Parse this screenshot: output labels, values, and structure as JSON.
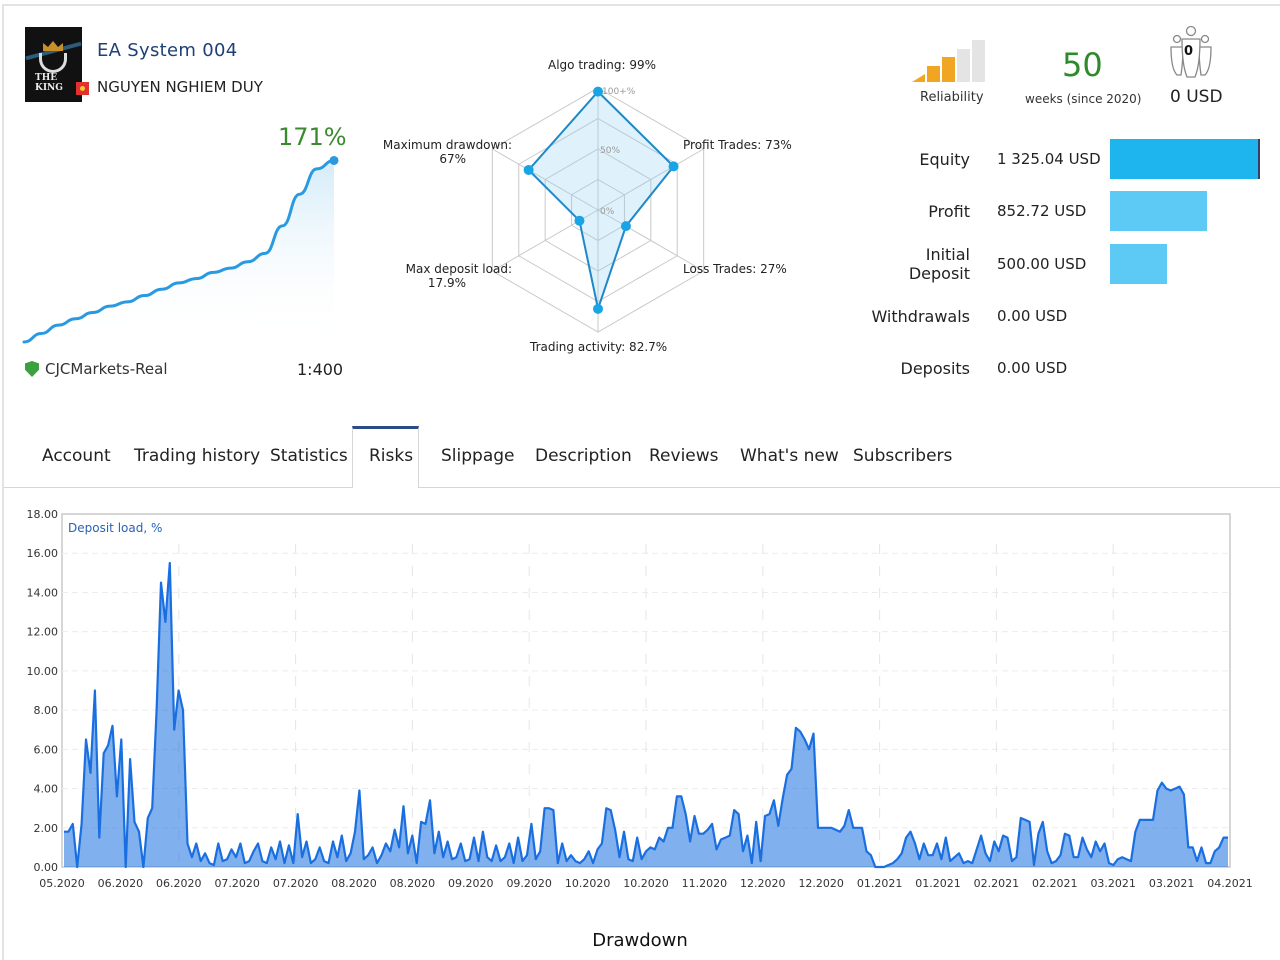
{
  "header": {
    "system_name": "EA System 004",
    "owner_name": "NGUYEN NGHIEM DUY",
    "avatar_text": "THE KING"
  },
  "growth": {
    "percent_label": "171%",
    "broker": "CJCMarkets-Real",
    "leverage": "1:400",
    "curve": [
      0,
      4,
      8,
      11,
      14,
      17,
      19,
      22,
      25,
      28,
      30,
      33,
      35,
      38,
      42,
      55,
      70,
      82,
      86
    ]
  },
  "radar": {
    "scale_labels": [
      "100+%",
      "50%",
      "0%"
    ],
    "axes": [
      {
        "label": "Algo trading: 99%",
        "value": 99
      },
      {
        "label": "Profit Trades: 73%",
        "value": 73
      },
      {
        "label": "Loss Trades: 27%",
        "value": 27
      },
      {
        "label": "Trading activity: 82.7%",
        "value": 82.7
      },
      {
        "label": "Max deposit load:\n17.9%",
        "value": 17.9
      },
      {
        "label": "Maximum drawdown:\n67%",
        "value": 67
      }
    ]
  },
  "stats": {
    "reliability_label": "Reliability",
    "reliability_level": 3,
    "reliability_max": 5,
    "weeks": "50",
    "weeks_label": "weeks (since 2020)",
    "subscribers_count": "0",
    "subscribers_funds": "0 USD"
  },
  "financials": [
    {
      "label": "Equity",
      "value": "1 325.04 USD",
      "amount": 1325.04,
      "color": "#1eb4ee"
    },
    {
      "label": "Profit",
      "value": "852.72 USD",
      "amount": 852.72,
      "color": "#5ccaf5"
    },
    {
      "label": "Initial Deposit",
      "value": "500.00 USD",
      "amount": 500.0,
      "color": "#5ccaf5"
    },
    {
      "label": "Withdrawals",
      "value": "0.00 USD",
      "amount": 0,
      "color": "#5ccaf5"
    },
    {
      "label": "Deposits",
      "value": "0.00 USD",
      "amount": 0,
      "color": "#5ccaf5"
    }
  ],
  "tabs": [
    {
      "label": "Account",
      "active": false
    },
    {
      "label": "Trading history",
      "active": false
    },
    {
      "label": "Statistics",
      "active": false
    },
    {
      "label": "Risks",
      "active": true
    },
    {
      "label": "Slippage",
      "active": false
    },
    {
      "label": "Description",
      "active": false
    },
    {
      "label": "Reviews",
      "active": false
    },
    {
      "label": "What's new",
      "active": false
    },
    {
      "label": "Subscribers",
      "active": false
    }
  ],
  "chart_data": {
    "type": "line",
    "title": "Drawdown",
    "legend": "Deposit load, %",
    "legend_position": "top-left",
    "xlabel": "",
    "ylabel": "",
    "ylim": [
      0,
      18
    ],
    "yticks": [
      "0.00",
      "2.00",
      "4.00",
      "6.00",
      "8.00",
      "10.00",
      "12.00",
      "14.00",
      "16.00",
      "18.00"
    ],
    "xticks": [
      "05.2020",
      "06.2020",
      "06.2020",
      "07.2020",
      "07.2020",
      "08.2020",
      "08.2020",
      "09.2020",
      "09.2020",
      "10.2020",
      "10.2020",
      "11.2020",
      "12.2020",
      "12.2020",
      "01.2021",
      "01.2021",
      "02.2021",
      "02.2021",
      "03.2021",
      "03.2021",
      "04.2021"
    ],
    "grid": true,
    "series": [
      {
        "name": "Deposit load, %",
        "color": "#1a6fe0",
        "values": [
          1.8,
          1.8,
          2.2,
          0,
          2.2,
          6.5,
          4.8,
          9.0,
          1.5,
          5.8,
          6.2,
          7.2,
          3.6,
          6.5,
          0,
          5.5,
          2.3,
          1.8,
          0,
          2.5,
          3.0,
          8.0,
          14.5,
          12.5,
          15.5,
          7.0,
          9.0,
          8.0,
          1.2,
          0.5,
          1.2,
          0.3,
          0.7,
          0.2,
          0.1,
          1.2,
          0.3,
          0.4,
          0.9,
          0.5,
          1.2,
          0.2,
          0.3,
          0.8,
          1.2,
          0.3,
          0.2,
          1.0,
          0.4,
          1.3,
          0.2,
          1.1,
          0.2,
          2.7,
          0.5,
          1.3,
          0.2,
          0.4,
          1.0,
          0.3,
          0.2,
          1.3,
          0.5,
          1.6,
          0.3,
          0.7,
          1.8,
          3.9,
          0.4,
          0.6,
          1.0,
          0.2,
          0.6,
          1.2,
          0.8,
          1.9,
          1.0,
          3.1,
          0.7,
          1.6,
          0.2,
          2.3,
          2.2,
          3.4,
          0.7,
          1.8,
          0.5,
          1.3,
          0.4,
          0.5,
          1.2,
          0.3,
          0.4,
          1.5,
          0.3,
          1.8,
          0.5,
          0.3,
          1.1,
          0.3,
          0.5,
          1.2,
          0.2,
          1.5,
          0.3,
          0.6,
          2.2,
          0.4,
          0.8,
          3.0,
          3.0,
          2.9,
          0.2,
          1.2,
          0.3,
          0.6,
          0.3,
          0.2,
          0.4,
          0.8,
          0.2,
          0.9,
          1.2,
          3.0,
          2.9,
          1.9,
          0.5,
          1.8,
          0.4,
          0.3,
          1.5,
          0.4,
          0.8,
          1.0,
          0.9,
          1.5,
          1.3,
          2.0,
          2.0,
          3.6,
          3.6,
          2.7,
          1.3,
          2.6,
          1.7,
          1.7,
          1.9,
          2.2,
          0.9,
          1.4,
          1.5,
          1.6,
          2.9,
          2.7,
          0.8,
          1.6,
          0.2,
          2.3,
          0.3,
          2.6,
          2.7,
          3.4,
          2.1,
          3.5,
          4.7,
          5.0,
          7.1,
          6.9,
          6.5,
          6.0,
          6.8,
          2.0,
          2.0,
          2.0,
          2.0,
          1.9,
          1.8,
          2.1,
          2.9,
          2.0,
          2.0,
          2.0,
          0.8,
          0.6,
          0,
          0,
          0,
          0.1,
          0.2,
          0.4,
          0.7,
          1.5,
          1.8,
          1.2,
          0.4,
          1.2,
          0.6,
          0.6,
          1.2,
          0.4,
          1.5,
          0.3,
          0.5,
          0.7,
          0.2,
          0.3,
          0.2,
          0.9,
          1.6,
          0.7,
          0.3,
          1.3,
          0.8,
          1.6,
          1.5,
          0.3,
          0.5,
          2.5,
          2.4,
          2.3,
          0.1,
          1.7,
          2.3,
          0.8,
          0.2,
          0.3,
          0.6,
          1.7,
          1.6,
          0.5,
          0.5,
          1.5,
          0.9,
          0.5,
          1.3,
          0.8,
          1.2,
          0.2,
          0.1,
          0.4,
          0.5,
          0.4,
          0.3,
          1.8,
          2.4,
          2.4,
          2.4,
          2.4,
          3.9,
          4.3,
          4.0,
          3.9,
          4.0,
          4.1,
          3.7,
          1.0,
          1.0,
          0.3,
          1.0,
          0.2,
          0.2,
          0.8,
          1.0,
          1.5,
          1.5
        ]
      }
    ]
  }
}
